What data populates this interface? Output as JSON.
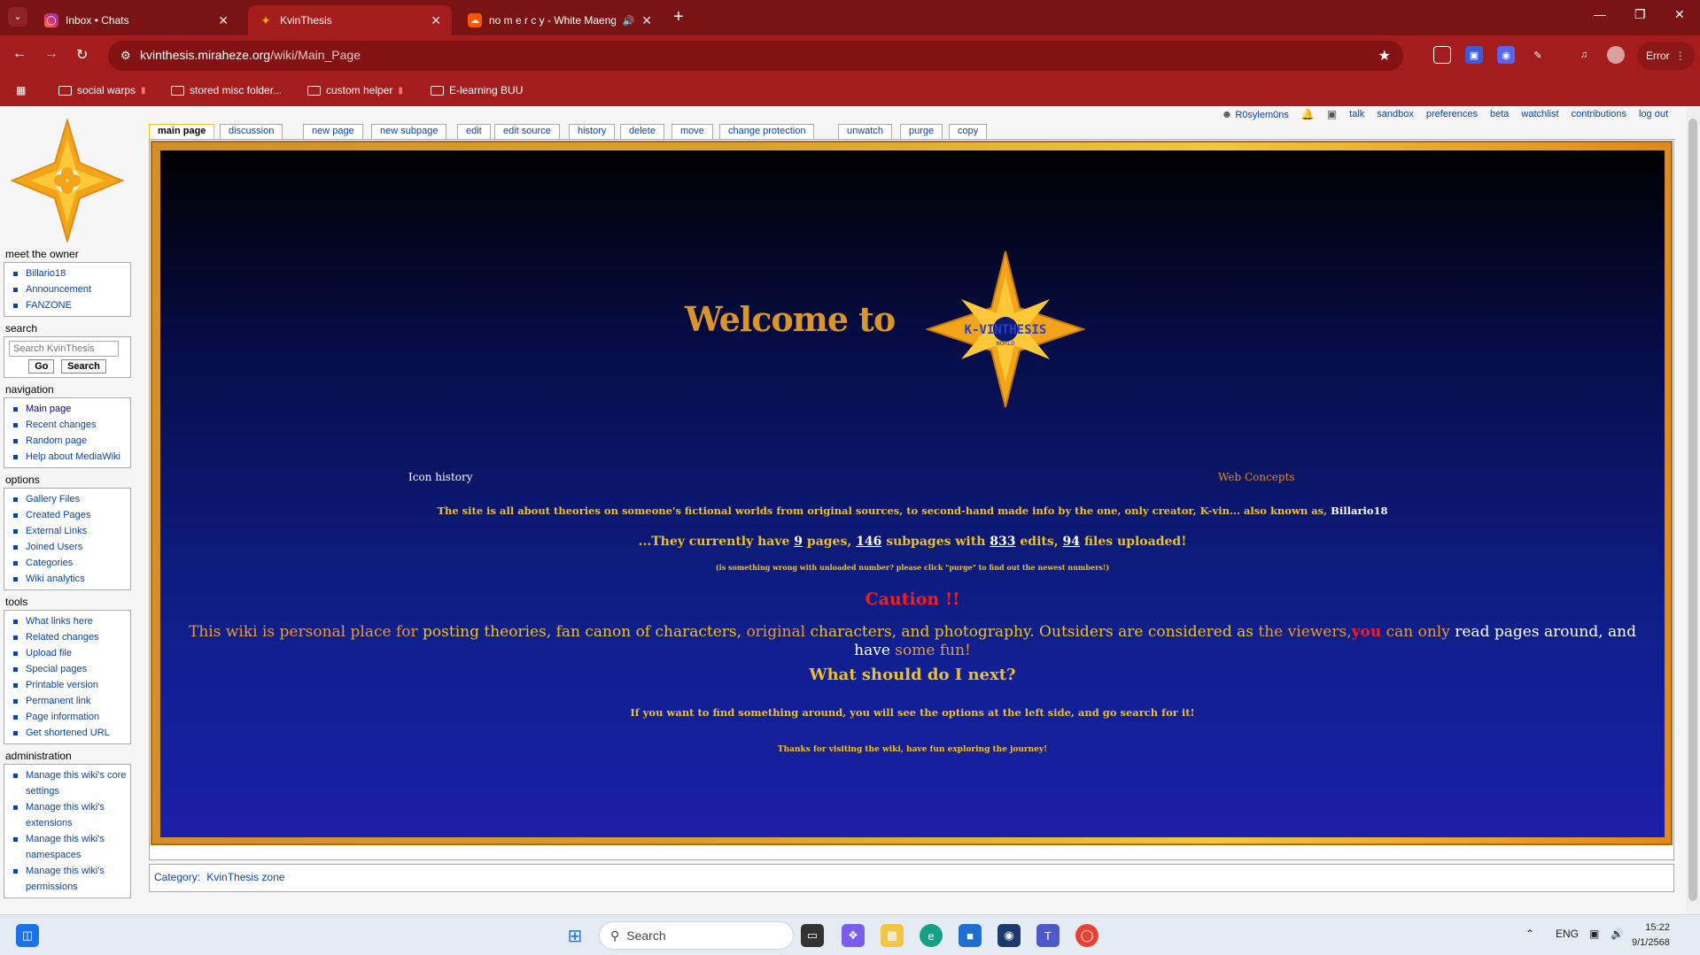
{
  "browser": {
    "tabs": [
      {
        "title": "Inbox • Chats",
        "active": false
      },
      {
        "title": "KvinThesis",
        "active": true
      },
      {
        "title": "no m e r c y - White Maeng",
        "active": false
      }
    ],
    "url_domain": "kvinthesis.miraheze.org",
    "url_path": "/wiki/Main_Page",
    "profile_label": "Error",
    "bookmarks": [
      "social warps",
      "stored misc folder...",
      "custom helper",
      "E-learning BUU"
    ]
  },
  "personal_tools": {
    "username": "R0sylem0ns",
    "links": [
      "talk",
      "sandbox",
      "preferences",
      "beta",
      "watchlist",
      "contributions",
      "log out"
    ]
  },
  "content_tabs": [
    "main page",
    "discussion",
    "new page",
    "new subpage",
    "edit",
    "edit source",
    "history",
    "delete",
    "move",
    "change protection",
    "unwatch",
    "purge",
    "copy"
  ],
  "sidebar": {
    "meet_owner": {
      "title": "meet the owner",
      "items": [
        "Billario18",
        "Announcement",
        "FANZONE"
      ]
    },
    "search": {
      "title": "search",
      "placeholder": "Search KvinThesis",
      "go": "Go",
      "search": "Search"
    },
    "navigation": {
      "title": "navigation",
      "items": [
        "Main page",
        "Recent changes",
        "Random page",
        "Help about MediaWiki"
      ]
    },
    "options": {
      "title": "options",
      "items": [
        "Gallery Files",
        "Created Pages",
        "External Links",
        "Joined Users",
        "Categories",
        "Wiki analytics"
      ]
    },
    "tools": {
      "title": "tools",
      "items": [
        "What links here",
        "Related changes",
        "Upload file",
        "Special pages",
        "Printable version",
        "Permanent link",
        "Page information",
        "Get shortened URL"
      ]
    },
    "administration": {
      "title": "administration",
      "items": [
        "Manage this wiki's core settings",
        "Manage this wiki's extensions",
        "Manage this wiki's namespaces",
        "Manage this wiki's permissions"
      ]
    }
  },
  "banner": {
    "welcome": "Welcome to",
    "logo_text": "K-VINTHESIS",
    "logo_subtext": "WORLD",
    "link_left": "Icon history",
    "link_right": "Web Concepts",
    "line1_text": "The site is all about theories on someone's fictional worlds from original sources, to second-hand made info by the one, only creator, K-vin... also known as,",
    "line1_owner": "Billario18",
    "stats": {
      "prefix": "...They currently have",
      "pages": "9",
      "pages_label": "pages,",
      "subpages": "146",
      "subpages_label": "subpages with",
      "edits": "833",
      "edits_label": "edits,",
      "files": "94",
      "files_label": "files uploaded!"
    },
    "line3": "(is something wrong with unloaded number? please click \"purge\" to find out the newest numbers!)",
    "caution": "Caution !!",
    "notice": {
      "part1": "This wiki is personal place for",
      "part2": "posting theories, fan canon of characters,",
      "part3": "original",
      "part4": "characters, and photography. Outsiders are considered as",
      "part5": "the viewers,",
      "part6": "you",
      "part7": "can only",
      "part8": "read pages around, and have",
      "part9": "some fun!"
    },
    "next_heading": "What should do I next?",
    "find_line": "If you want to find something around, you will see the options at the left side, and go search for it!",
    "thanks": "Thanks for visiting the wiki, have fun exploring the journey!"
  },
  "category": {
    "label": "Category:",
    "value": "KvinThesis zone"
  },
  "taskbar": {
    "search_placeholder": "Search",
    "language": "ENG",
    "time": "15:22",
    "date": "9/1/2568"
  },
  "colors": {
    "browser_red": "#a51c1c",
    "banner_gold": "#f0c020",
    "link_blue": "#0645ad"
  }
}
